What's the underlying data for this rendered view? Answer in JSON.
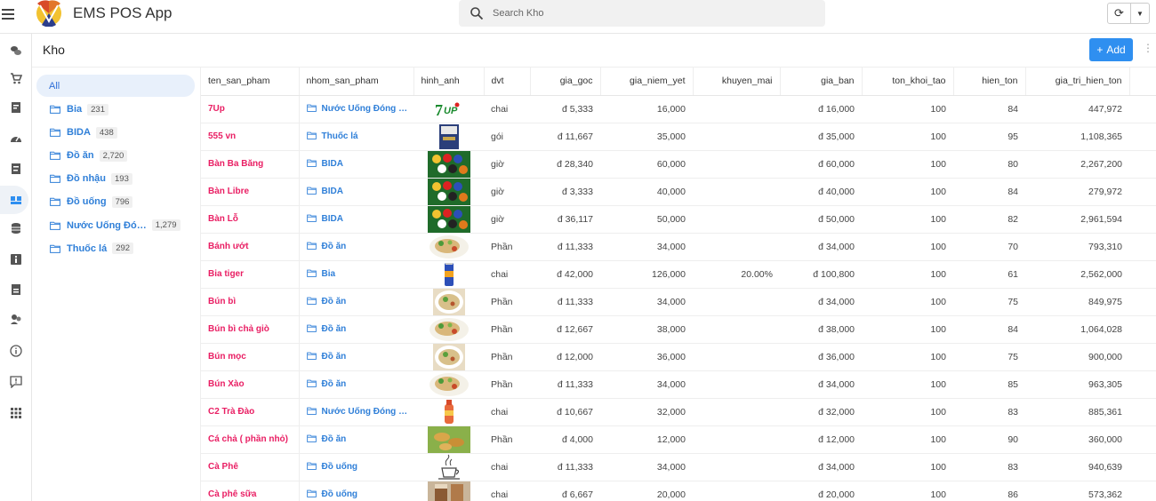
{
  "app": {
    "title": "EMS POS App"
  },
  "search": {
    "placeholder": "Search Kho"
  },
  "page": {
    "title": "Kho",
    "add_label": "Add"
  },
  "categories": {
    "all_label": "All",
    "items": [
      {
        "label": "Bia",
        "count": "231"
      },
      {
        "label": "BIDA",
        "count": "438"
      },
      {
        "label": "Đồ ăn",
        "count": "2,720"
      },
      {
        "label": "Đồ nhậu",
        "count": "193"
      },
      {
        "label": "Đồ uống",
        "count": "796"
      },
      {
        "label": "Nước Uống Đó…",
        "count": "1,279"
      },
      {
        "label": "Thuốc lá",
        "count": "292"
      }
    ]
  },
  "table": {
    "columns": [
      "ten_san_pham",
      "nhom_san_pham",
      "hinh_anh",
      "dvt",
      "gia_goc",
      "gia_niem_yet",
      "khuyen_mai",
      "gia_ban",
      "ton_khoi_tao",
      "hien_ton",
      "gia_tri_hien_ton"
    ],
    "rows": [
      {
        "ten_san_pham": "7Up",
        "nhom_san_pham": "Nước Uống Đóng …",
        "image": "7up-logo",
        "dvt": "chai",
        "gia_goc": "đ 5,333",
        "gia_niem_yet": "16,000",
        "khuyen_mai": "",
        "gia_ban": "đ 16,000",
        "ton_khoi_tao": "100",
        "hien_ton": "84",
        "gia_tri_hien_ton": "447,972"
      },
      {
        "ten_san_pham": "555 vn",
        "nhom_san_pham": "Thuốc lá",
        "image": "cigarette-pack",
        "dvt": "gói",
        "gia_goc": "đ 11,667",
        "gia_niem_yet": "35,000",
        "khuyen_mai": "",
        "gia_ban": "đ 35,000",
        "ton_khoi_tao": "100",
        "hien_ton": "95",
        "gia_tri_hien_ton": "1,108,365"
      },
      {
        "ten_san_pham": "Bàn Ba Băng",
        "nhom_san_pham": "BIDA",
        "image": "billiard-balls",
        "dvt": "giờ",
        "gia_goc": "đ 28,340",
        "gia_niem_yet": "60,000",
        "khuyen_mai": "",
        "gia_ban": "đ 60,000",
        "ton_khoi_tao": "100",
        "hien_ton": "80",
        "gia_tri_hien_ton": "2,267,200"
      },
      {
        "ten_san_pham": "Bàn Libre",
        "nhom_san_pham": "BIDA",
        "image": "billiard-balls",
        "dvt": "giờ",
        "gia_goc": "đ 3,333",
        "gia_niem_yet": "40,000",
        "khuyen_mai": "",
        "gia_ban": "đ 40,000",
        "ton_khoi_tao": "100",
        "hien_ton": "84",
        "gia_tri_hien_ton": "279,972"
      },
      {
        "ten_san_pham": "Bàn Lỗ",
        "nhom_san_pham": "BIDA",
        "image": "billiard-balls",
        "dvt": "giờ",
        "gia_goc": "đ 36,117",
        "gia_niem_yet": "50,000",
        "khuyen_mai": "",
        "gia_ban": "đ 50,000",
        "ton_khoi_tao": "100",
        "hien_ton": "82",
        "gia_tri_hien_ton": "2,961,594"
      },
      {
        "ten_san_pham": "Bánh ướt",
        "nhom_san_pham": "Đồ ăn",
        "image": "food-plate",
        "dvt": "Phần",
        "gia_goc": "đ 11,333",
        "gia_niem_yet": "34,000",
        "khuyen_mai": "",
        "gia_ban": "đ 34,000",
        "ton_khoi_tao": "100",
        "hien_ton": "70",
        "gia_tri_hien_ton": "793,310"
      },
      {
        "ten_san_pham": "Bia tiger",
        "nhom_san_pham": "Bia",
        "image": "beer-can",
        "dvt": "chai",
        "gia_goc": "đ 42,000",
        "gia_niem_yet": "126,000",
        "khuyen_mai": "20.00%",
        "gia_ban": "đ 100,800",
        "ton_khoi_tao": "100",
        "hien_ton": "61",
        "gia_tri_hien_ton": "2,562,000"
      },
      {
        "ten_san_pham": "Bún bì",
        "nhom_san_pham": "Đồ ăn",
        "image": "noodle-bowl",
        "dvt": "Phần",
        "gia_goc": "đ 11,333",
        "gia_niem_yet": "34,000",
        "khuyen_mai": "",
        "gia_ban": "đ 34,000",
        "ton_khoi_tao": "100",
        "hien_ton": "75",
        "gia_tri_hien_ton": "849,975"
      },
      {
        "ten_san_pham": "Bún bì chả giò",
        "nhom_san_pham": "Đồ ăn",
        "image": "food-plate",
        "dvt": "Phần",
        "gia_goc": "đ 12,667",
        "gia_niem_yet": "38,000",
        "khuyen_mai": "",
        "gia_ban": "đ 38,000",
        "ton_khoi_tao": "100",
        "hien_ton": "84",
        "gia_tri_hien_ton": "1,064,028"
      },
      {
        "ten_san_pham": "Bún mọc",
        "nhom_san_pham": "Đồ ăn",
        "image": "noodle-bowl",
        "dvt": "Phần",
        "gia_goc": "đ 12,000",
        "gia_niem_yet": "36,000",
        "khuyen_mai": "",
        "gia_ban": "đ 36,000",
        "ton_khoi_tao": "100",
        "hien_ton": "75",
        "gia_tri_hien_ton": "900,000"
      },
      {
        "ten_san_pham": "Bún Xào",
        "nhom_san_pham": "Đồ ăn",
        "image": "food-plate",
        "dvt": "Phần",
        "gia_goc": "đ 11,333",
        "gia_niem_yet": "34,000",
        "khuyen_mai": "",
        "gia_ban": "đ 34,000",
        "ton_khoi_tao": "100",
        "hien_ton": "85",
        "gia_tri_hien_ton": "963,305"
      },
      {
        "ten_san_pham": "C2 Trà Đào",
        "nhom_san_pham": "Nước Uống Đóng …",
        "image": "tea-bottle",
        "dvt": "chai",
        "gia_goc": "đ 10,667",
        "gia_niem_yet": "32,000",
        "khuyen_mai": "",
        "gia_ban": "đ 32,000",
        "ton_khoi_tao": "100",
        "hien_ton": "83",
        "gia_tri_hien_ton": "885,361"
      },
      {
        "ten_san_pham": "Cá chả ( phần nhỏ)",
        "nhom_san_pham": "Đồ ăn",
        "image": "fish-cake",
        "dvt": "Phần",
        "gia_goc": "đ 4,000",
        "gia_niem_yet": "12,000",
        "khuyen_mai": "",
        "gia_ban": "đ 12,000",
        "ton_khoi_tao": "100",
        "hien_ton": "90",
        "gia_tri_hien_ton": "360,000"
      },
      {
        "ten_san_pham": "Cà Phê",
        "nhom_san_pham": "Đồ uống",
        "image": "coffee-cup",
        "dvt": "chai",
        "gia_goc": "đ 11,333",
        "gia_niem_yet": "34,000",
        "khuyen_mai": "",
        "gia_ban": "đ 34,000",
        "ton_khoi_tao": "100",
        "hien_ton": "83",
        "gia_tri_hien_ton": "940,639"
      },
      {
        "ten_san_pham": "Cà phê sữa",
        "nhom_san_pham": "Đồ uống",
        "image": "iced-coffee",
        "dvt": "chai",
        "gia_goc": "đ 6,667",
        "gia_niem_yet": "20,000",
        "khuyen_mai": "",
        "gia_ban": "đ 20,000",
        "ton_khoi_tao": "100",
        "hien_ton": "86",
        "gia_tri_hien_ton": "573,362"
      }
    ]
  },
  "colors": {
    "accent": "#2f8ff0",
    "product_name": "#e91e63",
    "group": "#2f7fd8"
  }
}
